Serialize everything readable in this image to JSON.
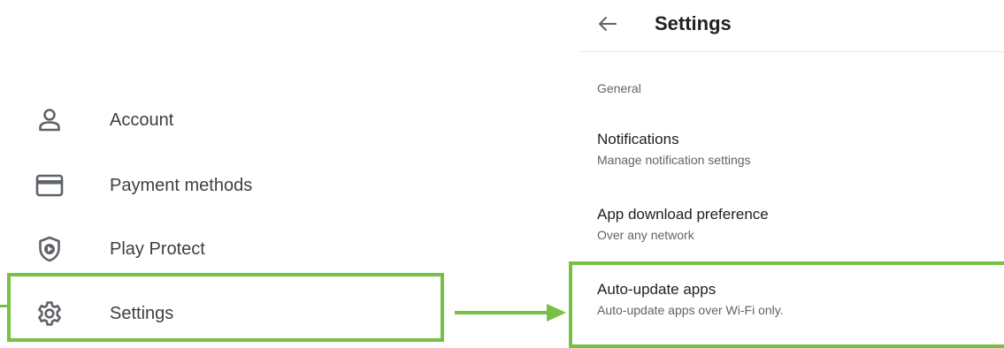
{
  "menu": {
    "items": [
      {
        "label": "Account",
        "icon": "person-icon"
      },
      {
        "label": "Payment methods",
        "icon": "credit-card-icon"
      },
      {
        "label": "Play Protect",
        "icon": "shield-play-icon"
      },
      {
        "label": "Settings",
        "icon": "gear-icon"
      }
    ]
  },
  "settings": {
    "title": "Settings",
    "section": "General",
    "items": [
      {
        "title": "Notifications",
        "subtitle": "Manage notification settings"
      },
      {
        "title": "App download preference",
        "subtitle": "Over any network"
      },
      {
        "title": "Auto-update apps",
        "subtitle": "Auto-update apps over Wi-Fi only."
      }
    ]
  },
  "colors": {
    "highlight": "#76c043",
    "text_primary": "#202124",
    "text_secondary": "#5f6368"
  }
}
